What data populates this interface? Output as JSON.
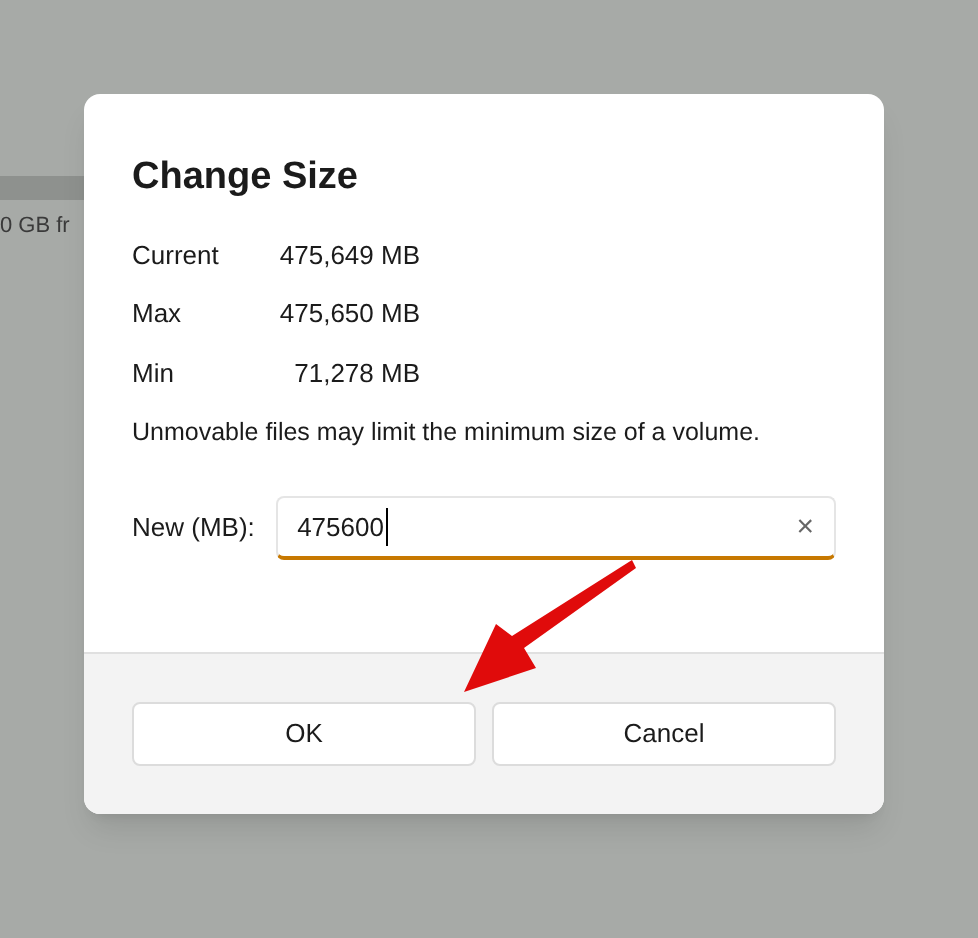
{
  "background": {
    "text": "0 GB fr"
  },
  "dialog": {
    "title": "Change Size",
    "info": [
      {
        "label": "Current",
        "value": "475,649 MB"
      },
      {
        "label": "Max",
        "value": "475,650 MB"
      },
      {
        "label": "Min",
        "value": "71,278 MB"
      }
    ],
    "note": "Unmovable files may limit the minimum size of a volume.",
    "field": {
      "label": "New (MB):",
      "value": "475600",
      "clear": "×"
    },
    "buttons": [
      {
        "label": "OK"
      },
      {
        "label": "Cancel"
      }
    ]
  }
}
